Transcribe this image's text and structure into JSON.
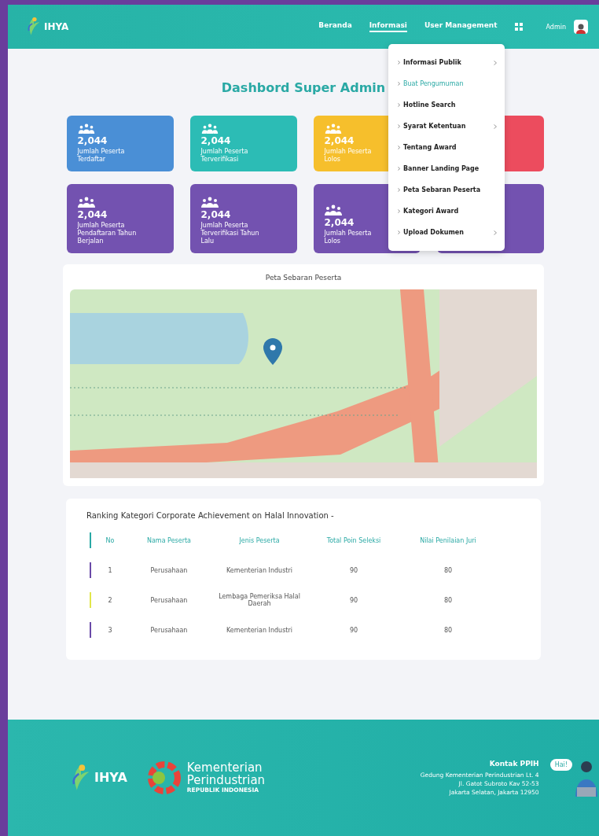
{
  "header": {
    "logo": "IHYA",
    "nav": [
      {
        "label": "Beranda",
        "selected": false
      },
      {
        "label": "Informasi",
        "selected": true
      },
      {
        "label": "User Management",
        "selected": false
      }
    ],
    "user": "Admin"
  },
  "dropdown": {
    "items": [
      {
        "label": "Informasi Publik",
        "selected": false,
        "submenu": true
      },
      {
        "label": "Buat Pengumuman",
        "selected": true,
        "submenu": false
      },
      {
        "label": "Hotline Search",
        "selected": false,
        "submenu": false
      },
      {
        "label": "Syarat Ketentuan",
        "selected": false,
        "submenu": true
      },
      {
        "label": "Tentang Award",
        "selected": false,
        "submenu": false
      },
      {
        "label": "Banner Landing Page",
        "selected": false,
        "submenu": false
      },
      {
        "label": "Peta Sebaran Peserta",
        "selected": false,
        "submenu": false
      },
      {
        "label": "Kategori Award",
        "selected": false,
        "submenu": false
      },
      {
        "label": "Upload Dokumen",
        "selected": false,
        "submenu": true
      }
    ]
  },
  "title": "Dashbord Super Admin",
  "stats": [
    {
      "value": "2,044",
      "label": "Jumlah Peserta Terdaftar",
      "color": "#4a8fd6"
    },
    {
      "value": "2,044",
      "label": "Jumlah Peserta Terverifikasi",
      "color": "#2cbcb5"
    },
    {
      "value": "2,044",
      "label": "Jumlah Peserta Lolos",
      "color": "#f6bf2c"
    },
    {
      "color": "#ec4c5e"
    },
    {
      "value": "2,044",
      "label": "Jumlah Peserta Pendaftaran Tahun Berjalan",
      "color": "#7352b0"
    },
    {
      "value": "2,044",
      "label": "Jumlah Peserta Terverifikasi Tahun Lalu",
      "color": "#7352b0"
    },
    {
      "value": "2,044",
      "label": "Jumlah Peserta Lolos",
      "color": "#7352b0"
    },
    {
      "color": "#7352b0"
    }
  ],
  "map": {
    "title": "Peta Sebaran Peserta"
  },
  "ranking": {
    "title": "Ranking Kategori Corporate Achievement on Halal Innovation -",
    "columns": [
      "No",
      "Nama Peserta",
      "Jenis Peserta",
      "Total Poin Seleksi",
      "Nilai Penilaian Juri"
    ],
    "rows": [
      {
        "color": "#6a4aa8",
        "cells": [
          "1",
          "Perusahaan",
          "Kementerian Industri",
          "90",
          "80"
        ]
      },
      {
        "color": "#e2e64a",
        "cells": [
          "2",
          "Perusahaan",
          "Lembaga Pemeriksa Halal Daerah",
          "90",
          "80"
        ]
      },
      {
        "color": "#6a4aa8",
        "cells": [
          "3",
          "Perusahaan",
          "Kementerian Industri",
          "90",
          "80"
        ]
      }
    ]
  },
  "footer": {
    "logo": "IHYA",
    "ministry": "Kementerian",
    "ministry2": "Perindustrian",
    "country": "REPUBLIK INDONESIA",
    "contact_title": "Kontak PPIH",
    "address": [
      "Gedung Kementerian Perindustrian Lt. 4",
      "Jl. Gatot Subroto Kav 52-53",
      "Jakarta Selatan, Jakarta 12950"
    ],
    "bubble": "Hai!"
  }
}
